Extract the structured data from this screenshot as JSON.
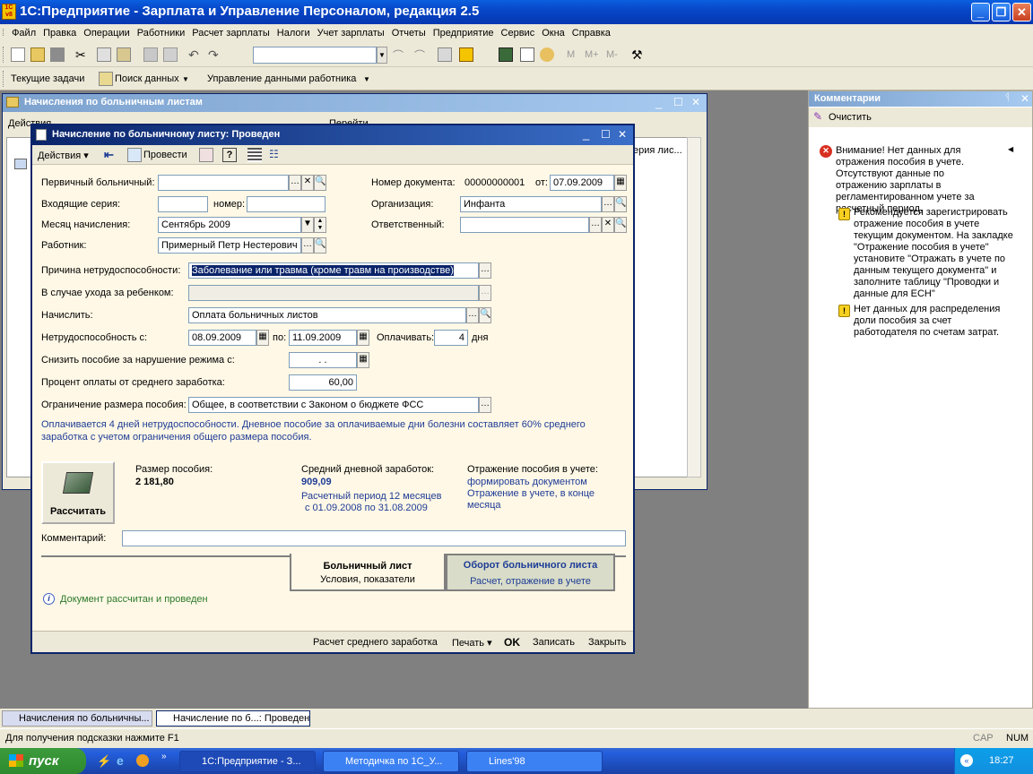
{
  "app": {
    "title": "1С:Предприятие - Зарплата и Управление Персоналом, редакция 2.5",
    "icon_text": "1C v8"
  },
  "menu": [
    "Файл",
    "Правка",
    "Операции",
    "Работники",
    "Расчет зарплаты",
    "Налоги",
    "Учет зарплаты",
    "Отчеты",
    "Предприятие",
    "Сервис",
    "Окна",
    "Справка"
  ],
  "toolbar2": {
    "tasks": "Текущие задачи",
    "search": "Поиск данных",
    "manage": "Управление данными работника"
  },
  "toolbar_m": [
    "M",
    "M+",
    "M-"
  ],
  "list_window": {
    "title": "Начисления по больничным листам",
    "actions": "Действия",
    "col_fragment": "ерия лис...",
    "goto": "Перейти"
  },
  "dialog": {
    "title": "Начисление по больничному листу: Проведен",
    "toolbar": {
      "actions": "Действия",
      "post": "Провести"
    },
    "fields": {
      "primary_sick_label": "Первичный больничный:",
      "primary_sick": "",
      "incoming_series_label": "Входящие серия:",
      "incoming_series": "",
      "number_label": "номер:",
      "number": "",
      "month_label": "Месяц начисления:",
      "month": "Сентябрь 2009",
      "employee_label": "Работник:",
      "employee": "Примерный Петр Нестерович",
      "doc_number_label": "Номер документа:",
      "doc_number": "00000000001",
      "from_label": "от:",
      "doc_date": "07.09.2009",
      "org_label": "Организация:",
      "org": "Инфанта",
      "responsible_label": "Ответственный:",
      "responsible": "",
      "reason_label": "Причина нетрудоспособности:",
      "reason": "Заболевание или травма (кроме травм на производстве)",
      "child_care_label": "В случае ухода за ребенком:",
      "child_care": "",
      "accrue_label": "Начислить:",
      "accrue": "Оплата больничных листов",
      "disability_from_label": "Нетрудоспособность с:",
      "disability_from": "08.09.2009",
      "to_label": "по:",
      "disability_to": "11.09.2009",
      "pay_label": "Оплачивать:",
      "pay_days": "4",
      "days_label": "дня",
      "reduce_label": "Снизить пособие за нарушение режима с:",
      "reduce": ". .",
      "percent_label": "Процент оплаты от среднего заработка:",
      "percent": "60,00",
      "limit_label": "Ограничение размера пособия:",
      "limit": "Общее, в соответствии с Законом о бюджете ФСС"
    },
    "info": "Оплачивается 4 дней нетрудоспособности. Дневное пособие за оплачиваемые дни болезни составляет 60% среднего заработка с учетом ограничения общего размера пособия.",
    "calc_button": "Рассчитать",
    "benefit_label": "Размер пособия:",
    "benefit": "2 181,80",
    "avg_label": "Средний дневной заработок:",
    "avg": "909,09",
    "period_line1": "Расчетный период 12 месяцев",
    "period_line2": "с 01.09.2008 по 31.08.2009",
    "reflect_label": "Отражение пособия в учете:",
    "reflect_link": "формировать документом",
    "reflect_line2": "Отражение в учете, в конце",
    "reflect_line3": "месяца",
    "comment_label": "Комментарий:",
    "comment": "",
    "tab1_title": "Больничный лист",
    "tab1_sub": "Условия, показатели",
    "tab2_title": "Оборот больничного листа",
    "tab2_sub": "Расчет, отражение в учете",
    "status": "Документ рассчитан и проведен",
    "bottom": {
      "avg_calc": "Расчет среднего заработка",
      "print": "Печать",
      "ok": "OK",
      "save": "Записать",
      "close": "Закрыть"
    }
  },
  "comments": {
    "title": "Комментарии",
    "clear": "Очистить",
    "items": [
      {
        "type": "error",
        "text": "Внимание! Нет данных для отражения пособия в учете. Отсутствуют данные по отражению зарплаты в регламентированном учете за расчетный период."
      },
      {
        "type": "hint",
        "text": "Рекомендуется зарегистрировать отражение пособия в учете текущим документом. На закладке \"Отражение пособия в учете\" установите \"Отражать в учете по данным текущего документа\" и заполните таблицу \"Проводки и данные для ЕСН\""
      },
      {
        "type": "hint",
        "text": "Нет данных для распределения доли пособия за счет работодателя по счетам затрат."
      }
    ]
  },
  "window_tabs": [
    "Начисления по больничны...",
    "Начисление по б...: Проведен"
  ],
  "statusbar": {
    "hint": "Для получения подсказки нажмите F1",
    "cap": "CAP",
    "num": "NUM"
  },
  "taskbar": {
    "start": "пуск",
    "items": [
      "1С:Предприятие - З...",
      "Методичка по 1С_У...",
      "Lines'98"
    ],
    "lang": "RL",
    "time": "18:27"
  }
}
